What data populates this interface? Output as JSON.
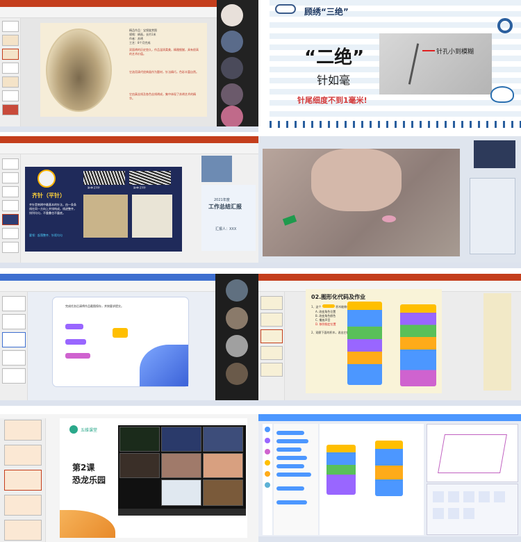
{
  "p1": {
    "body_lines": [
      "精品作品：宝镜鉴赏图",
      "规格：绢画，长约1米",
      "作者：苏绣",
      "工艺：8个月完成"
    ],
    "para1": "双面绣的历史悠久，作品温润柔美，精雅细腻，具有很高的艺术价值。",
    "para2": "它选用清代经典画作为题材，针法精巧，色彩丰富自然。",
    "para3": "它由真丝线及各色丝线绣成，集中体现了苏绣艺术的精华。"
  },
  "p2": {
    "title": "顾绣“三绝”",
    "big": "“二绝”",
    "sub": "针如毫",
    "arrow_label": "针孔小到模糊",
    "caption": "针尾细度不到1毫米!"
  },
  "p3": {
    "heading": "齐针（平针）",
    "label1": "第1种 正平针",
    "label2": "第2种 正平针",
    "body": "齐针是刺绣中最基本的针法，由一条条线在同一方向上并排构成，线迹整齐，排列均匀，不重叠也不露底。",
    "highlight": "要领：起落整齐、针距均匀",
    "card_year": "2021年度",
    "card_title": "工作总结汇报",
    "card_sub": "汇报人：XXX"
  },
  "p4": {},
  "p5": {
    "prompt": "完成任务后请将作品截图保存，并按要求提交。"
  },
  "p6": {
    "title": "02.图形化代码及作业",
    "q1": "1、这个",
    "q1b": "积木能做什么？",
    "choices": [
      "A. 改变角色位置",
      "B. 改变角色颜色",
      "C. 播放声音",
      "D. 移到指定位置"
    ],
    "q2": "2、观察下面的积木，说出它们的作用。"
  },
  "p7": {
    "brand": "五维课堂",
    "lesson": "第2课",
    "topic": "恐龙乐园"
  },
  "p8": {}
}
